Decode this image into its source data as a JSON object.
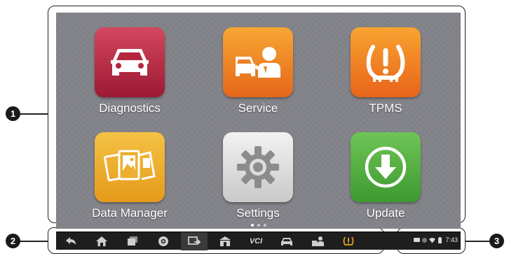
{
  "callouts": [
    "1",
    "2",
    "3"
  ],
  "apps": [
    {
      "label": "Diagnostics",
      "icon": "car-icon",
      "color": "#b4253f"
    },
    {
      "label": "Service",
      "icon": "mechanic-car-icon",
      "color": "#ee8225"
    },
    {
      "label": "TPMS",
      "icon": "tire-pressure-warning-icon",
      "color": "#f08424"
    },
    {
      "label": "Data Manager",
      "icon": "photo-files-icon",
      "color": "#ecae2e"
    },
    {
      "label": "Settings",
      "icon": "gear-icon",
      "color": "#dcdcdc"
    },
    {
      "label": "Update",
      "icon": "download-arrow-icon",
      "color": "#54b040"
    }
  ],
  "page_indicator": {
    "pages": 3,
    "current": 1
  },
  "nav_bar": {
    "buttons": [
      "back-icon",
      "home-icon",
      "recent-apps-icon",
      "browser-icon",
      "screen-capture-icon",
      "shop-icon",
      "vci-icon",
      "car-icon",
      "mechanic-icon",
      "tpms-icon"
    ],
    "vci_label": "VCI"
  },
  "status_bar": {
    "icons": [
      "message-icon",
      "settings-icon",
      "wifi-icon",
      "battery-icon"
    ],
    "time": "7:43"
  }
}
